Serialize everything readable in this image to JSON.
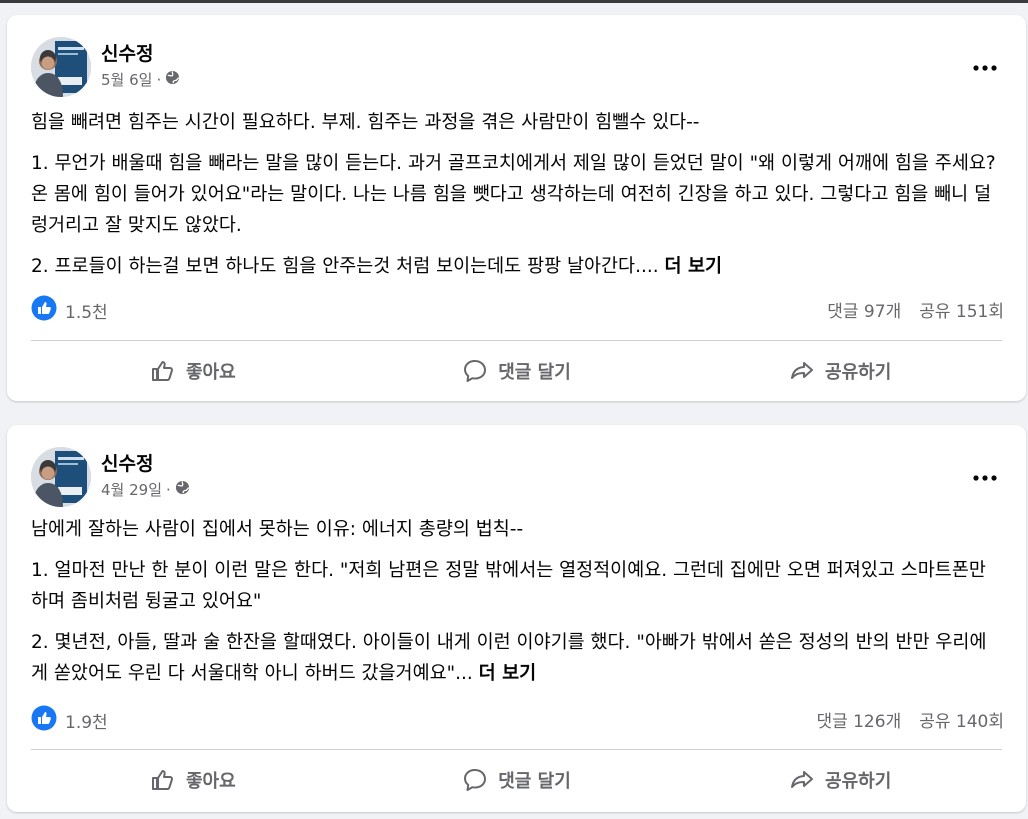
{
  "posts": [
    {
      "author": "신수정",
      "date": "5월 6일",
      "dot": "·",
      "paragraphs": [
        "힘을 빼려면 힘주는 시간이 필요하다. 부제. 힘주는 과정을 겪은 사람만이 힘뺄수 있다--",
        "1. 무언가 배울때 힘을 빼라는 말을 많이 듣는다. 과거 골프코치에게서 제일 많이 듣었던 말이 \"왜 이렇게 어깨에 힘을 주세요? 온 몸에 힘이 들어가 있어요\"라는 말이다. 나는 나름 힘을 뺏다고 생각하는데 여전히 긴장을 하고 있다. 그렇다고 힘을 빼니 덜렁거리고 잘 맞지도 않았다.",
        "2. 프로들이 하는걸 보면 하나도 힘을 안주는것 처럼 보이는데도 팡팡 날아간다...."
      ],
      "see_more": "더 보기",
      "likes": "1.5천",
      "comments": "댓글 97개",
      "shares": "공유 151회"
    },
    {
      "author": "신수정",
      "date": "4월 29일",
      "dot": "·",
      "paragraphs": [
        "남에게 잘하는 사람이 집에서 못하는 이유: 에너지 총량의 법칙--",
        "1. 얼마전 만난 한 분이 이런 말은 한다. \"저희 남편은 정말 밖에서는 열정적이예요. 그런데 집에만 오면 퍼져있고 스마트폰만 하며 좀비처럼 뒹굴고 있어요\"",
        "2. 몇년전, 아들, 딸과 술 한잔을 할때였다. 아이들이 내게 이런 이야기를 했다. \"아빠가 밖에서 쏟은 정성의 반의 반만 우리에게 쏟았어도 우린 다 서울대학 아니 하버드 갔을거예요\"..."
      ],
      "see_more": "더 보기",
      "likes": "1.9천",
      "comments": "댓글 126개",
      "shares": "공유 140회"
    }
  ],
  "actions": {
    "like": "좋아요",
    "comment": "댓글 달기",
    "share": "공유하기"
  },
  "icons": {
    "more": "more-horizontal-icon",
    "globe": "globe-icon",
    "like_reaction": "like-reaction-icon",
    "thumbs_up": "thumbs-up-icon",
    "comment": "comment-bubble-icon",
    "share": "share-arrow-icon"
  },
  "colors": {
    "background": "#f0f2f5",
    "card": "#ffffff",
    "secondary_text": "#65676b",
    "like_blue": "#1877f2"
  }
}
